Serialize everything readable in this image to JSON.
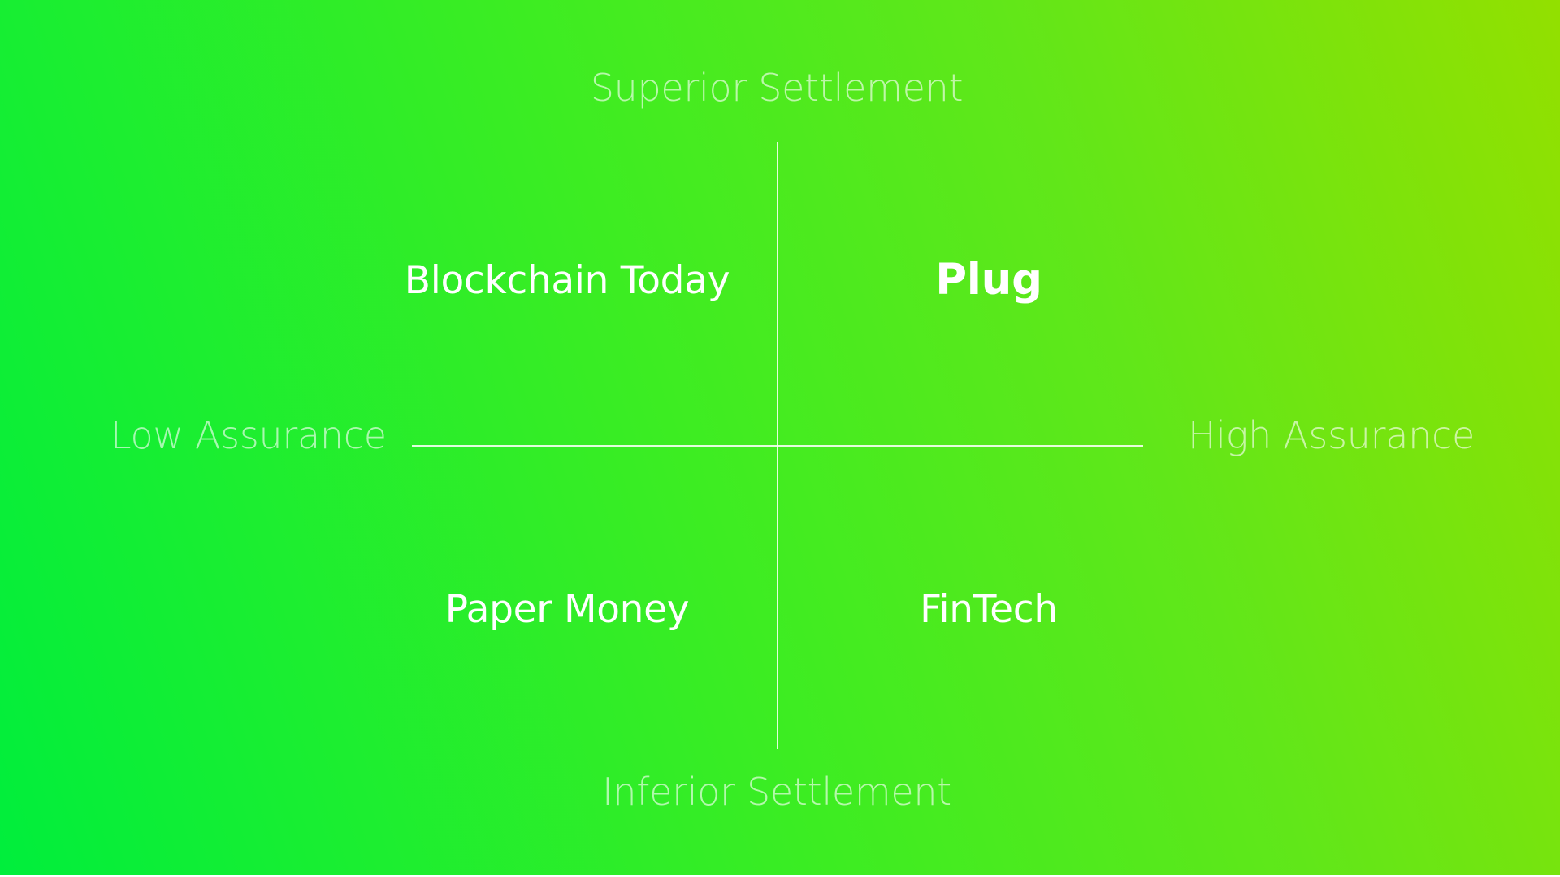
{
  "axes": {
    "top": "Superior Settlement",
    "bottom": "Inferior Settlement",
    "left": "Low Assurance",
    "right": "High Assurance"
  },
  "quadrants": {
    "top_left": "Blockchain Today",
    "top_right": "Plug",
    "bottom_left": "Paper Money",
    "bottom_right": "FinTech"
  },
  "colors": {
    "gradient_start": "#00ee3c",
    "gradient_end": "#93e000",
    "text": "#ffffff"
  }
}
